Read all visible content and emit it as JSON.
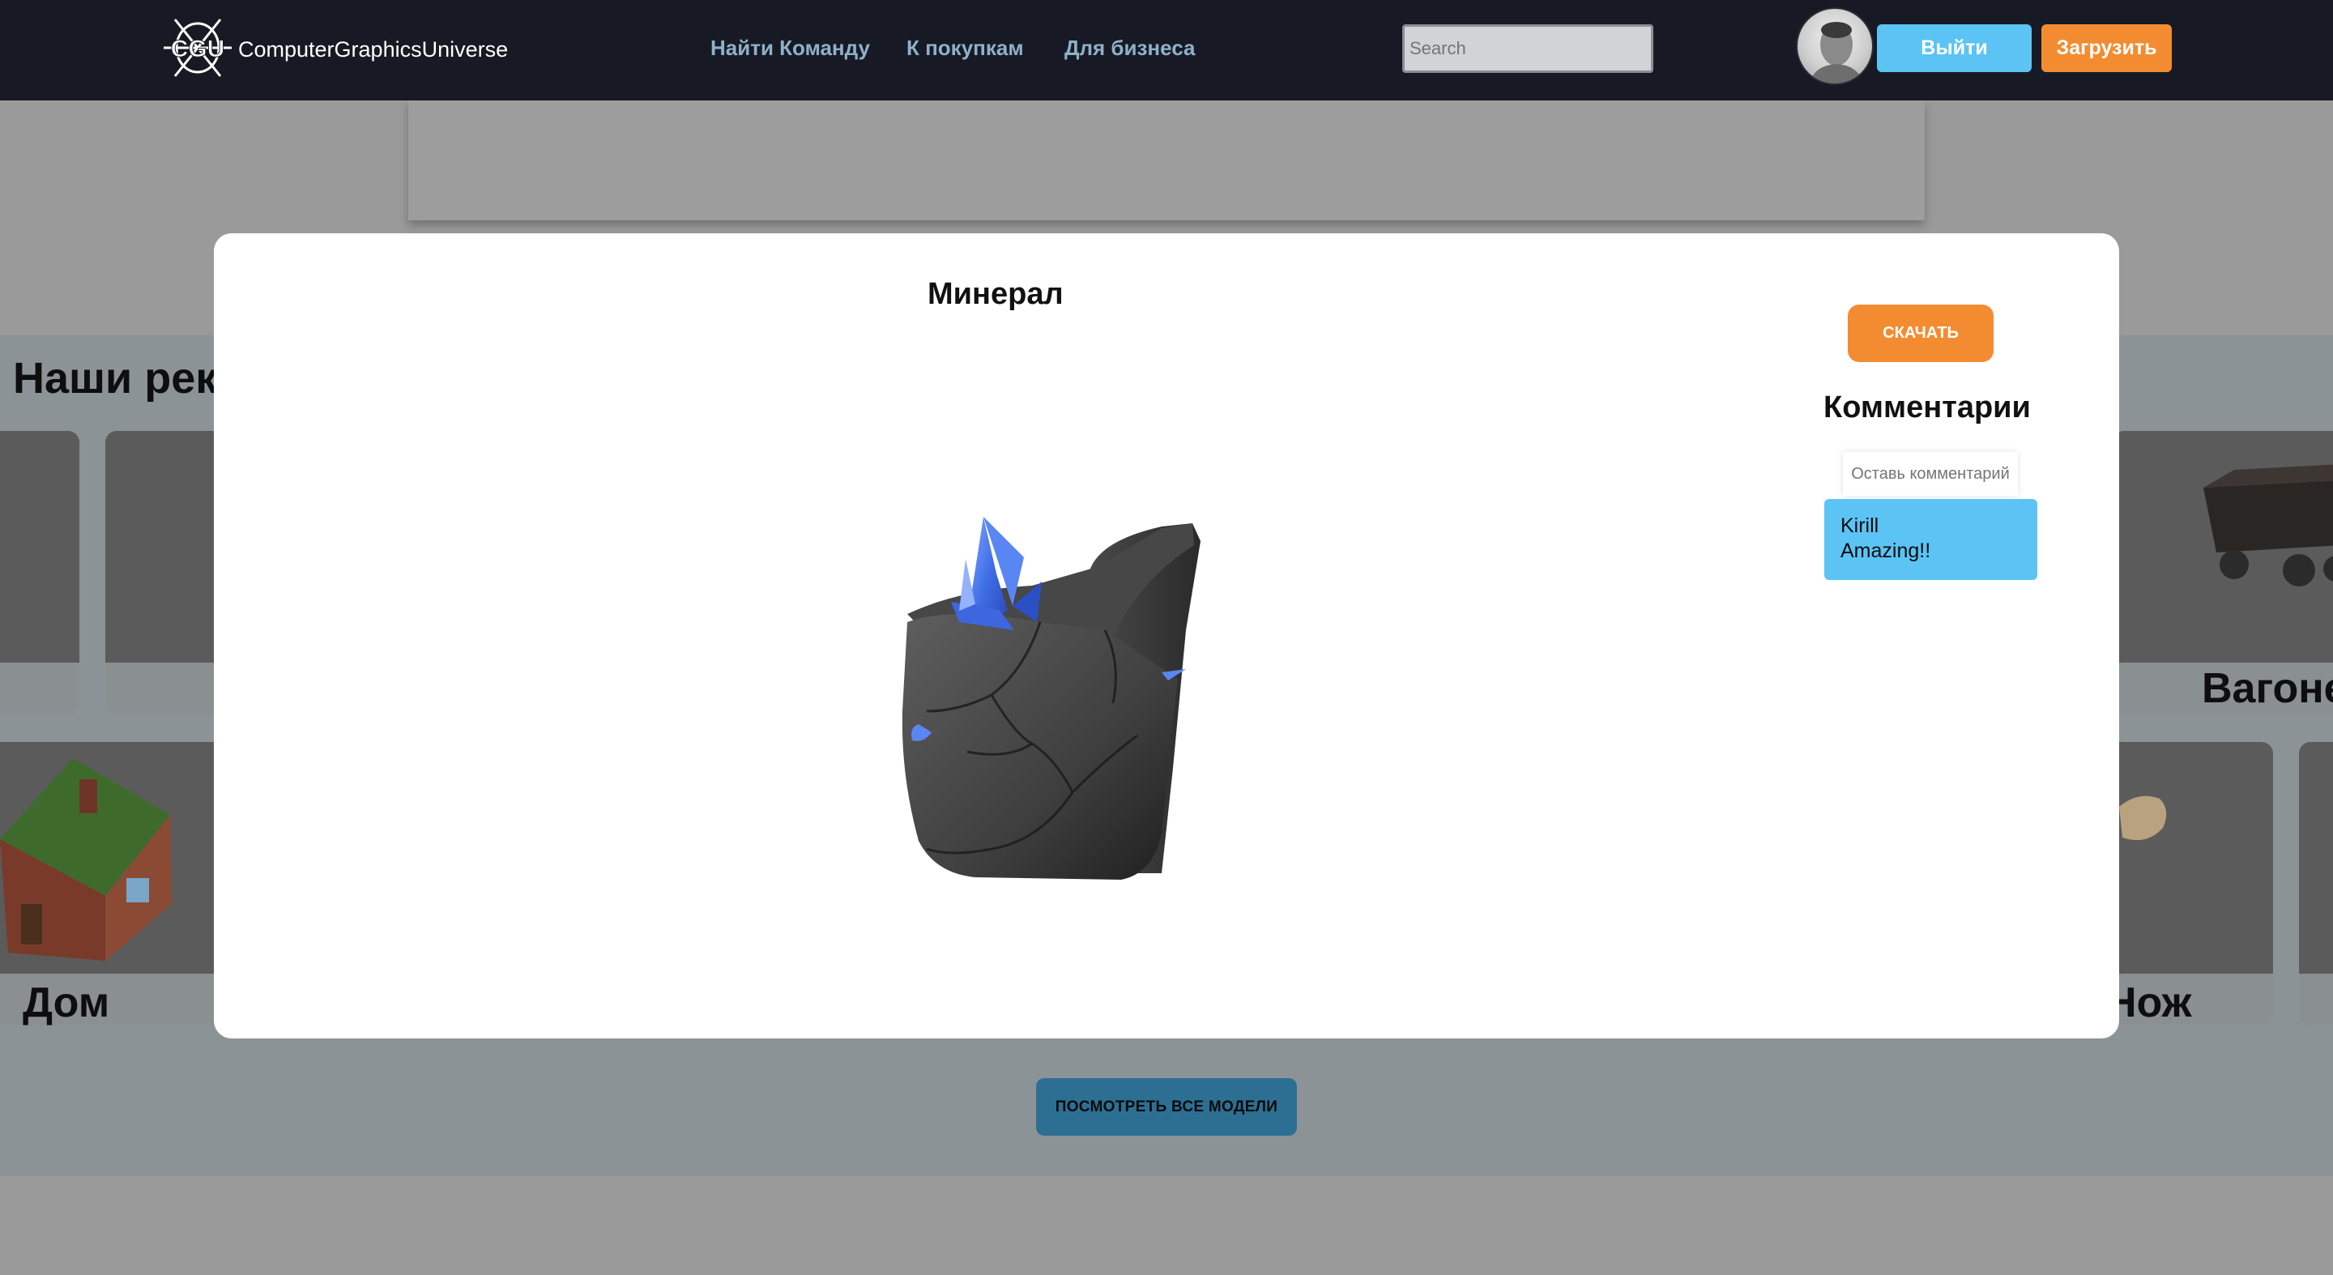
{
  "header": {
    "logo_text": "ComputerGraphicsUniverse",
    "logo_mark": "CGU",
    "nav": [
      {
        "label": "Найти Команду"
      },
      {
        "label": "К покупкам"
      },
      {
        "label": "Для бизнеса"
      }
    ],
    "search_placeholder": "Search",
    "logout_label": "Выйти",
    "upload_label": "Загрузить"
  },
  "page": {
    "recommendations_title": "Наши рекомендации",
    "cards": [
      {
        "label": "Дом"
      },
      {
        "label": "Вагонетка"
      },
      {
        "label": "Нож"
      }
    ],
    "view_all_label": "ПОСМОТРЕТЬ ВСЕ МОДЕЛИ"
  },
  "modal": {
    "title": "Минерал",
    "download_label": "СКАЧАТЬ",
    "comments_title": "Комментарии",
    "comment_placeholder": "Оставь комментарий",
    "comments": [
      {
        "author": "Kirill",
        "text": "Amazing!!"
      }
    ]
  },
  "colors": {
    "nav_bg": "#171a24",
    "accent_blue": "#5bc4f5",
    "accent_orange": "#f38c31",
    "nav_link": "#8fb0c9"
  }
}
